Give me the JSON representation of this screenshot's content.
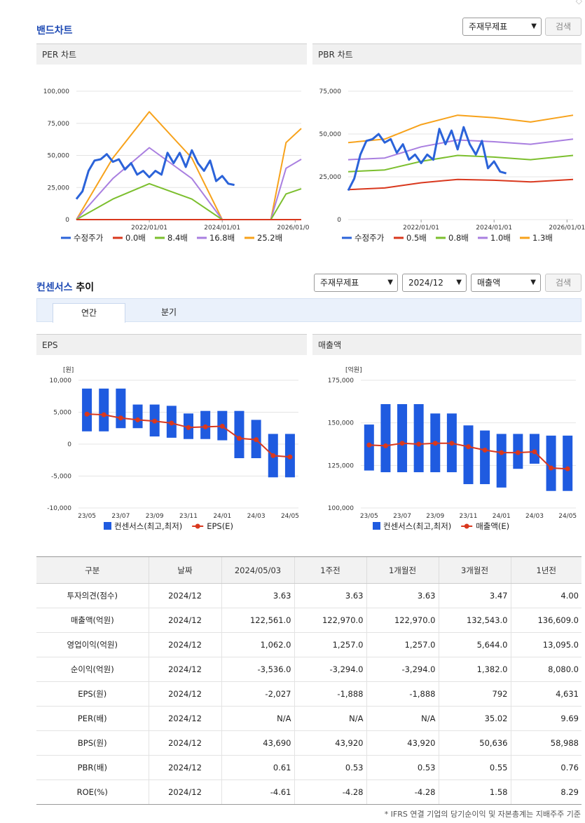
{
  "band": {
    "title": "밴드차트",
    "select": "주재무제표",
    "search": "검색",
    "per": {
      "header": "PER 차트",
      "yticks": [
        "100,000",
        "75,000",
        "50,000",
        "25,000",
        "0"
      ],
      "xticks": [
        "2022/01/01",
        "2024/01/01",
        "2026/01/01"
      ],
      "legend": [
        "수정주가",
        "0.0배",
        "8.4배",
        "16.8배",
        "25.2배"
      ]
    },
    "pbr": {
      "header": "PBR 차트",
      "yticks": [
        "75,000",
        "50,000",
        "25,000",
        "0"
      ],
      "xticks": [
        "2022/01/01",
        "2024/01/01",
        "2026/01/01"
      ],
      "legend": [
        "수정주가",
        "0.5배",
        "0.8배",
        "1.0배",
        "1.3배"
      ]
    }
  },
  "consensus": {
    "title_hl": "컨센서스",
    "title_rest": " 추이",
    "select1": "주재무제표",
    "select2": "2024/12",
    "select3": "매출액",
    "search": "검색",
    "tabs": [
      "연간",
      "분기"
    ],
    "eps": {
      "header": "EPS",
      "unit": "[원]",
      "yticks": [
        "10,000",
        "5,000",
        "0",
        "-5,000",
        "-10,000"
      ],
      "xticks": [
        "23/05",
        "23/07",
        "23/09",
        "23/11",
        "24/01",
        "24/03",
        "24/05"
      ],
      "legend": [
        "컨센서스(최고,최저)",
        "EPS(E)"
      ]
    },
    "sales": {
      "header": "매출액",
      "unit": "[억원]",
      "yticks": [
        "175,000",
        "150,000",
        "125,000",
        "100,000"
      ],
      "xticks": [
        "23/05",
        "23/07",
        "23/09",
        "23/11",
        "24/01",
        "24/03",
        "24/05"
      ],
      "legend": [
        "컨센서스(최고,최저)",
        "매출액(E)"
      ]
    }
  },
  "table": {
    "headers": [
      "구분",
      "날짜",
      "2024/05/03",
      "1주전",
      "1개월전",
      "3개월전",
      "1년전"
    ],
    "rows": [
      [
        "투자의견(점수)",
        "2024/12",
        "3.63",
        "3.63",
        "3.63",
        "3.47",
        "4.00"
      ],
      [
        "매출액(억원)",
        "2024/12",
        "122,561.0",
        "122,970.0",
        "122,970.0",
        "132,543.0",
        "136,609.0"
      ],
      [
        "영업이익(억원)",
        "2024/12",
        "1,062.0",
        "1,257.0",
        "1,257.0",
        "5,644.0",
        "13,095.0"
      ],
      [
        "순이익(억원)",
        "2024/12",
        "-3,536.0",
        "-3,294.0",
        "-3,294.0",
        "1,382.0",
        "8,080.0"
      ],
      [
        "EPS(원)",
        "2024/12",
        "-2,027",
        "-1,888",
        "-1,888",
        "792",
        "4,631"
      ],
      [
        "PER(배)",
        "2024/12",
        "N/A",
        "N/A",
        "N/A",
        "35.02",
        "9.69"
      ],
      [
        "BPS(원)",
        "2024/12",
        "43,690",
        "43,920",
        "43,920",
        "50,636",
        "58,988"
      ],
      [
        "PBR(배)",
        "2024/12",
        "0.61",
        "0.53",
        "0.53",
        "0.55",
        "0.76"
      ],
      [
        "ROE(%)",
        "2024/12",
        "-4.61",
        "-4.28",
        "-4.28",
        "1.58",
        "8.29"
      ]
    ]
  },
  "footnote": "* IFRS 연결 기업의 당기순이익 및 자본총계는 지배주주 기준",
  "colors": {
    "price": "#2b63d9",
    "band1": "#d9381e",
    "band2": "#7cbf2e",
    "band3": "#a97fe0",
    "band4": "#f7a21b",
    "consensus_bar": "#1f5be0",
    "estimate_line": "#d9381e"
  },
  "chart_data": [
    {
      "type": "line",
      "title": "PER 차트",
      "ylim": [
        0,
        100000
      ],
      "x_range": [
        "2020/01/01",
        "2026/03/01"
      ],
      "series": [
        {
          "name": "수정주가",
          "x": [
            "2020/01",
            "2020/03",
            "2020/05",
            "2020/07",
            "2020/09",
            "2020/11",
            "2021/01",
            "2021/03",
            "2021/05",
            "2021/07",
            "2021/09",
            "2021/11",
            "2022/01",
            "2022/03",
            "2022/05",
            "2022/07",
            "2022/09",
            "2022/11",
            "2023/01",
            "2023/03",
            "2023/05",
            "2023/07",
            "2023/09",
            "2023/11",
            "2024/01",
            "2024/03",
            "2024/05"
          ],
          "y": [
            16000,
            22000,
            38000,
            46000,
            47000,
            51000,
            45000,
            47000,
            39000,
            44000,
            35000,
            38000,
            33000,
            38000,
            35000,
            52000,
            44000,
            52000,
            41000,
            54000,
            44000,
            38000,
            46000,
            30000,
            34000,
            28000,
            27000
          ]
        },
        {
          "name": "0.0배",
          "x": [
            "2020/01",
            "2026/03"
          ],
          "y": [
            0,
            0
          ]
        },
        {
          "name": "8.4배",
          "x": [
            "2020/01",
            "2021/01",
            "2022/01",
            "2023/03",
            "2024/01",
            "2025/05",
            "2025/10",
            "2026/03"
          ],
          "y": [
            0,
            16000,
            28000,
            16000,
            0,
            0,
            20000,
            24000
          ]
        },
        {
          "name": "16.8배",
          "x": [
            "2020/01",
            "2021/01",
            "2022/01",
            "2023/03",
            "2024/01",
            "2025/05",
            "2025/10",
            "2026/03"
          ],
          "y": [
            0,
            32000,
            56000,
            32000,
            0,
            0,
            40000,
            47000
          ]
        },
        {
          "name": "25.2배",
          "x": [
            "2020/01",
            "2021/01",
            "2022/01",
            "2023/03",
            "2024/01",
            "2025/05",
            "2025/10",
            "2026/03"
          ],
          "y": [
            0,
            48000,
            84000,
            48000,
            0,
            0,
            60000,
            71000
          ]
        }
      ]
    },
    {
      "type": "line",
      "title": "PBR 차트",
      "ylim": [
        0,
        75000
      ],
      "x_range": [
        "2020/01/01",
        "2026/03/01"
      ],
      "series": [
        {
          "name": "수정주가",
          "x": [
            "2020/01",
            "2020/03",
            "2020/05",
            "2020/07",
            "2020/09",
            "2020/11",
            "2021/01",
            "2021/03",
            "2021/05",
            "2021/07",
            "2021/09",
            "2021/11",
            "2022/01",
            "2022/03",
            "2022/05",
            "2022/07",
            "2022/09",
            "2022/11",
            "2023/01",
            "2023/03",
            "2023/05",
            "2023/07",
            "2023/09",
            "2023/11",
            "2024/01",
            "2024/03",
            "2024/05"
          ],
          "y": [
            17000,
            24000,
            38000,
            46000,
            47000,
            50000,
            45000,
            47000,
            39000,
            44000,
            35000,
            38000,
            33000,
            38000,
            35000,
            53000,
            44000,
            52000,
            41000,
            54000,
            44000,
            38000,
            46000,
            30000,
            34000,
            28000,
            27000
          ]
        },
        {
          "name": "0.5배",
          "x": [
            "2020/01",
            "2021/01",
            "2022/01",
            "2023/01",
            "2024/01",
            "2025/01",
            "2026/03"
          ],
          "y": [
            17500,
            18500,
            21500,
            23500,
            23000,
            22000,
            23500
          ]
        },
        {
          "name": "0.8배",
          "x": [
            "2020/01",
            "2021/01",
            "2022/01",
            "2023/01",
            "2024/01",
            "2025/01",
            "2026/03"
          ],
          "y": [
            28000,
            29000,
            34000,
            37500,
            36500,
            35000,
            37500
          ]
        },
        {
          "name": "1.0배",
          "x": [
            "2020/01",
            "2021/01",
            "2022/01",
            "2023/01",
            "2024/01",
            "2025/01",
            "2026/03"
          ],
          "y": [
            35000,
            36000,
            42500,
            46500,
            45500,
            44000,
            47000
          ]
        },
        {
          "name": "1.3배",
          "x": [
            "2020/01",
            "2021/01",
            "2022/01",
            "2023/01",
            "2024/01",
            "2025/01",
            "2026/03"
          ],
          "y": [
            45000,
            47000,
            55500,
            61000,
            59500,
            57000,
            61000
          ]
        }
      ]
    },
    {
      "type": "bar",
      "title": "EPS",
      "ylabel": "[원]",
      "ylim": [
        -10000,
        10000
      ],
      "categories": [
        "23/05",
        "",
        "23/07",
        "",
        "23/09",
        "",
        "23/11",
        "",
        "24/01",
        "",
        "24/03",
        "",
        "24/05"
      ],
      "series": [
        {
          "name": "컨센서스(최고,최저)",
          "high": [
            8700,
            8700,
            8700,
            6200,
            6200,
            6000,
            4800,
            5200,
            5200,
            5200,
            3800,
            1600,
            1600
          ],
          "low": [
            2000,
            2000,
            2500,
            2500,
            1200,
            1000,
            800,
            800,
            600,
            -2200,
            -2200,
            -5200,
            -5200
          ]
        },
        {
          "name": "EPS(E)",
          "values": [
            4700,
            4600,
            4100,
            3800,
            3600,
            3300,
            2600,
            2700,
            2800,
            900,
            700,
            -1800,
            -2000
          ]
        }
      ]
    },
    {
      "type": "bar",
      "title": "매출액",
      "ylabel": "[억원]",
      "ylim": [
        100000,
        175000
      ],
      "categories": [
        "23/05",
        "",
        "23/07",
        "",
        "23/09",
        "",
        "23/11",
        "",
        "24/01",
        "",
        "24/03",
        "",
        "24/05"
      ],
      "series": [
        {
          "name": "컨센서스(최고,최저)",
          "high": [
            149000,
            161000,
            161000,
            161000,
            155500,
            155500,
            148500,
            145500,
            143500,
            143500,
            143500,
            142500,
            142500
          ],
          "low": [
            122000,
            121000,
            121000,
            121000,
            121000,
            121000,
            114000,
            114000,
            112000,
            123000,
            126000,
            110000,
            110000
          ]
        },
        {
          "name": "매출액(E)",
          "values": [
            137000,
            136500,
            138000,
            137500,
            138000,
            138000,
            136000,
            134000,
            132500,
            132500,
            133000,
            123500,
            123000
          ]
        }
      ]
    }
  ]
}
